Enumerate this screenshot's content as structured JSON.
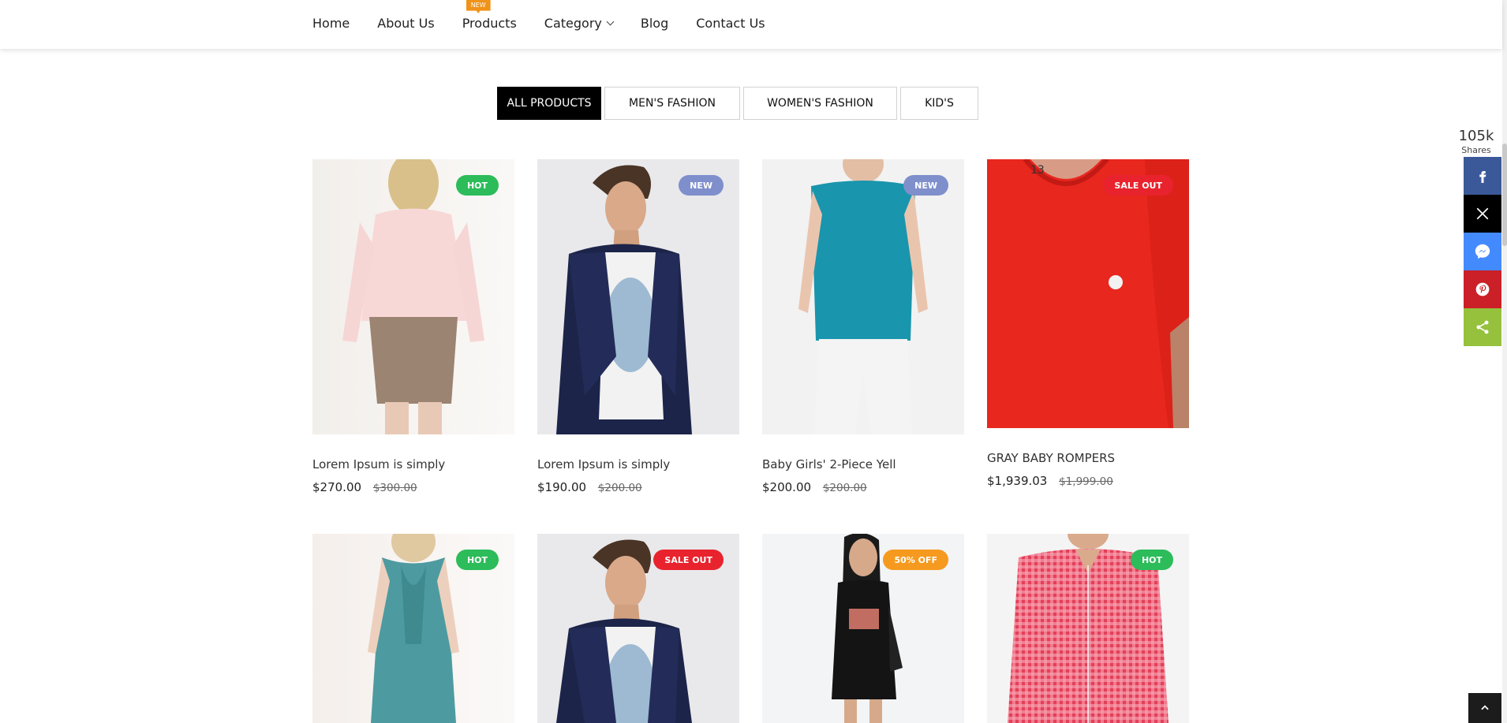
{
  "nav": {
    "items": [
      {
        "label": "Home"
      },
      {
        "label": "About Us"
      },
      {
        "label": "Products",
        "badge": "NEW"
      },
      {
        "label": "Category"
      },
      {
        "label": "Blog"
      },
      {
        "label": "Contact Us"
      }
    ]
  },
  "tabs": [
    "ALL PRODUCTS",
    "MEN'S FASHION",
    "WOMEN'S FASHION",
    "KID'S"
  ],
  "products": [
    {
      "name": "Lorem Ipsum is simply",
      "price": "$270.00",
      "old_price": "$300.00",
      "badge": "HOT"
    },
    {
      "name": "Lorem Ipsum is simply",
      "price": "$190.00",
      "old_price": "$200.00",
      "badge": "NEW"
    },
    {
      "name": "Baby Girls' 2-Piece Yell",
      "price": "$200.00",
      "old_price": "$200.00",
      "badge": "NEW"
    },
    {
      "name": "GRAY BABY ROMPERS",
      "price": "$1,939.03",
      "old_price": "$1,999.00",
      "badge": "SALE OUT"
    },
    {
      "badge": "HOT"
    },
    {
      "badge": "SALE OUT"
    },
    {
      "badge": "50% OFF"
    },
    {
      "badge": "HOT"
    }
  ],
  "colors": {
    "hot": "#2cbc5a",
    "new": "#7f8fcc",
    "sale": "#e8232d",
    "off": "#f59a1e",
    "facebook": "#3b5998",
    "x": "#000000",
    "messenger": "#448aff",
    "pinterest": "#cb2027",
    "share": "#95c13d"
  },
  "share": {
    "count": "105k",
    "label": "Shares"
  }
}
